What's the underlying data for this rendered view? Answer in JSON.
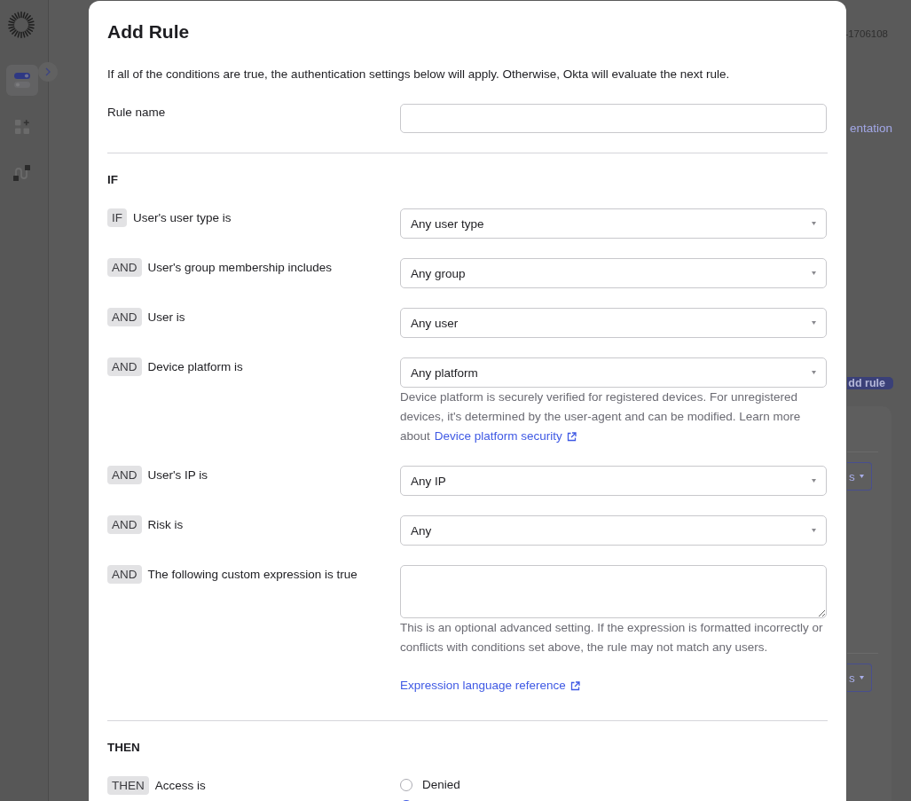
{
  "sidebar": {
    "items": [
      {
        "kind": "toggles",
        "selected": true
      },
      {
        "kind": "apps",
        "selected": false
      },
      {
        "kind": "workflow",
        "selected": false
      }
    ]
  },
  "background_page": {
    "header": {
      "id_text": "-1706108",
      "link": "entation"
    },
    "add_rule_button": "dd rule",
    "card": {
      "dropdowns": [
        {
          "label": "s"
        },
        {
          "label": "s"
        }
      ]
    }
  },
  "dialog": {
    "title": "Add Rule",
    "description": "If all of the conditions are true, the authentication settings below will apply. Otherwise, Okta will evaluate the next rule.",
    "rule_name": {
      "label": "Rule name"
    },
    "if_section": {
      "heading": "IF",
      "conditions": [
        {
          "operator": "IF",
          "label": "User's user type is",
          "kind": "select",
          "value": "Any user type"
        },
        {
          "operator": "AND",
          "label": "User's group membership includes",
          "kind": "select",
          "value": "Any group"
        },
        {
          "operator": "AND",
          "label": "User is",
          "kind": "select",
          "value": "Any user"
        },
        {
          "operator": "AND",
          "label": "Device platform is",
          "kind": "select",
          "value": "Any platform",
          "hint": "Device platform is securely verified for registered devices. For unregistered devices, it's determined by the user-agent and can be modified. Learn more about",
          "hint_link": "Device platform security"
        },
        {
          "operator": "AND",
          "label": "User's IP is",
          "kind": "select",
          "value": "Any IP"
        },
        {
          "operator": "AND",
          "label": "Risk is",
          "kind": "select",
          "value": "Any"
        },
        {
          "operator": "AND",
          "label": "The following custom expression is true",
          "kind": "textarea",
          "hint": "This is an optional advanced setting. If the expression is formatted incorrectly or conflicts with conditions set above, the rule may not match any users.",
          "link": "Expression language reference"
        }
      ]
    },
    "then_section": {
      "heading": "THEN",
      "rows": [
        {
          "operator": "THEN",
          "label": "Access is",
          "options": [
            {
              "label": "Denied",
              "selected": false
            },
            {
              "selected": true
            }
          ]
        }
      ]
    }
  }
}
